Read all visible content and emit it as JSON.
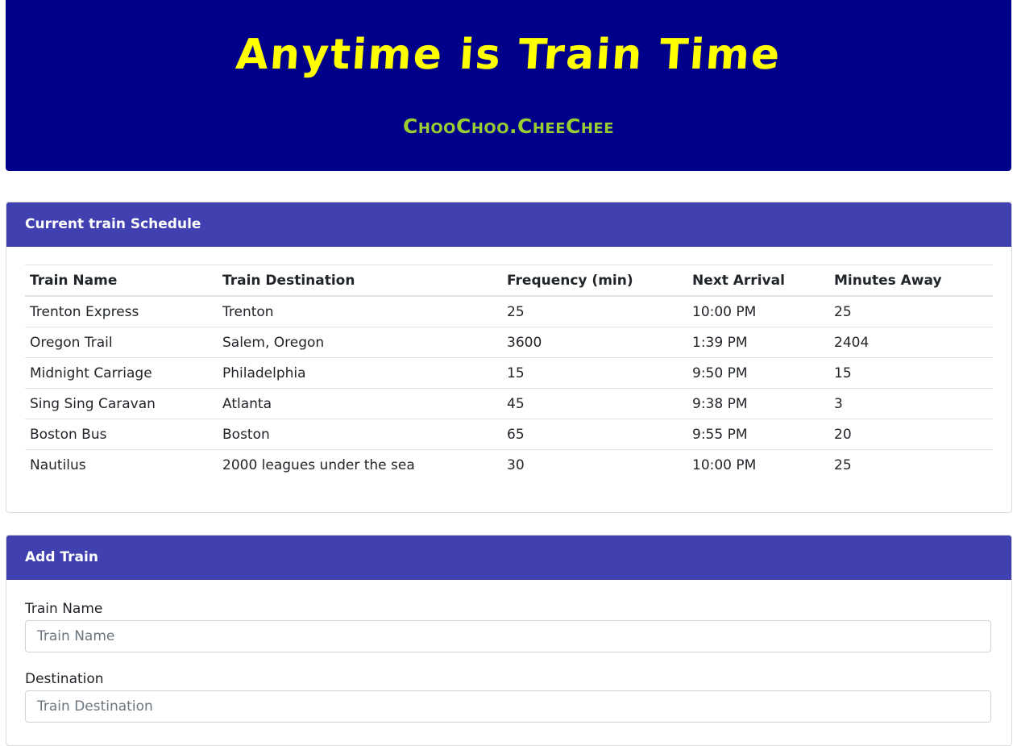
{
  "header": {
    "title": "Anytime is Train Time",
    "subtitle": "ChooChoo.CheeChee"
  },
  "schedule": {
    "title": "Current train Schedule",
    "columns": [
      "Train Name",
      "Train Destination",
      "Frequency (min)",
      "Next Arrival",
      "Minutes Away"
    ],
    "rows": [
      [
        "Trenton Express",
        "Trenton",
        "25",
        "10:00 PM",
        "25"
      ],
      [
        "Oregon Trail",
        "Salem, Oregon",
        "3600",
        "1:39 PM",
        "2404"
      ],
      [
        "Midnight Carriage",
        "Philadelphia",
        "15",
        "9:50 PM",
        "15"
      ],
      [
        "Sing Sing Caravan",
        "Atlanta",
        "45",
        "9:38 PM",
        "3"
      ],
      [
        "Boston Bus",
        "Boston",
        "65",
        "9:55 PM",
        "20"
      ],
      [
        "Nautilus",
        "2000 leagues under the sea",
        "30",
        "10:00 PM",
        "25"
      ]
    ]
  },
  "add_train": {
    "title": "Add Train",
    "name_label": "Train Name",
    "name_placeholder": "Train Name",
    "name_value": "",
    "destination_label": "Destination",
    "destination_placeholder": "Train Destination",
    "destination_value": ""
  },
  "colors": {
    "jumbotron": "#00008b",
    "title": "#ffff00",
    "subtitle": "#9acd32",
    "card_header": "#4040b0"
  }
}
